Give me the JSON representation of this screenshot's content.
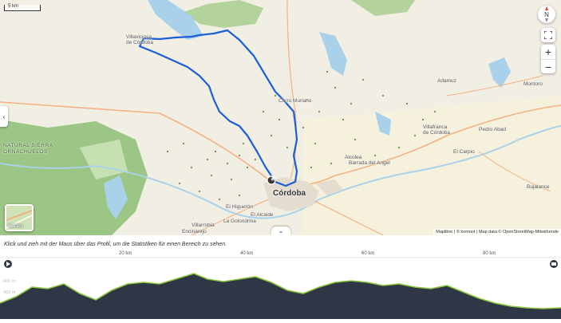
{
  "map": {
    "scale_label": "5 km",
    "labels": {
      "villaviciosa": [
        "Villaviciosa",
        "de Córdoba"
      ],
      "cerro_muriano": "Cerro Muriano",
      "adamuz": "Adamuz",
      "montoro": "Montoro",
      "villafranca": [
        "Villafranca",
        "de Córdoba"
      ],
      "pedro_abad": "Pedro Abad",
      "el_carpio": "El Carpio",
      "alcolea": "Alcolea",
      "barrada": "Barrada del Angel",
      "cordoba": "Córdoba",
      "el_higueron": "El Higuerón",
      "villarrubia": "Villarrubia",
      "la_golondrina": "La Golondrina",
      "encinarejo": "Encinarejo",
      "el_alcaide": "El Alcaide",
      "bujalance": "Bujalance",
      "natural_park": [
        "NATURAL SIERRA",
        "ORNACHUELOS"
      ]
    },
    "start_marker": "A",
    "compass_label": "N",
    "zoom_in": "+",
    "zoom_out": "−",
    "side_toggle": "‹",
    "map_type_label": "Karten",
    "attribution": "Maplibre | © komoot | Map data © OpenStreetMap-Mitwirkende",
    "collapse_label": "⌄"
  },
  "profile": {
    "hint": "Klick und zieh mit der Maus über das Profil, um die Statistiken für einen Bereich zu sehen.",
    "distance_ticks": [
      "20 km",
      "40 km",
      "60 km",
      "80 km"
    ],
    "elevation_labels": [
      "600 m",
      "400 m"
    ],
    "colors": {
      "fill": "#2f3645",
      "line": "#8cc63f"
    }
  },
  "colors": {
    "route": "#1a5fd6",
    "water": "#a9d2ea",
    "forest": "#9cc686",
    "land": "#f1efe4"
  }
}
